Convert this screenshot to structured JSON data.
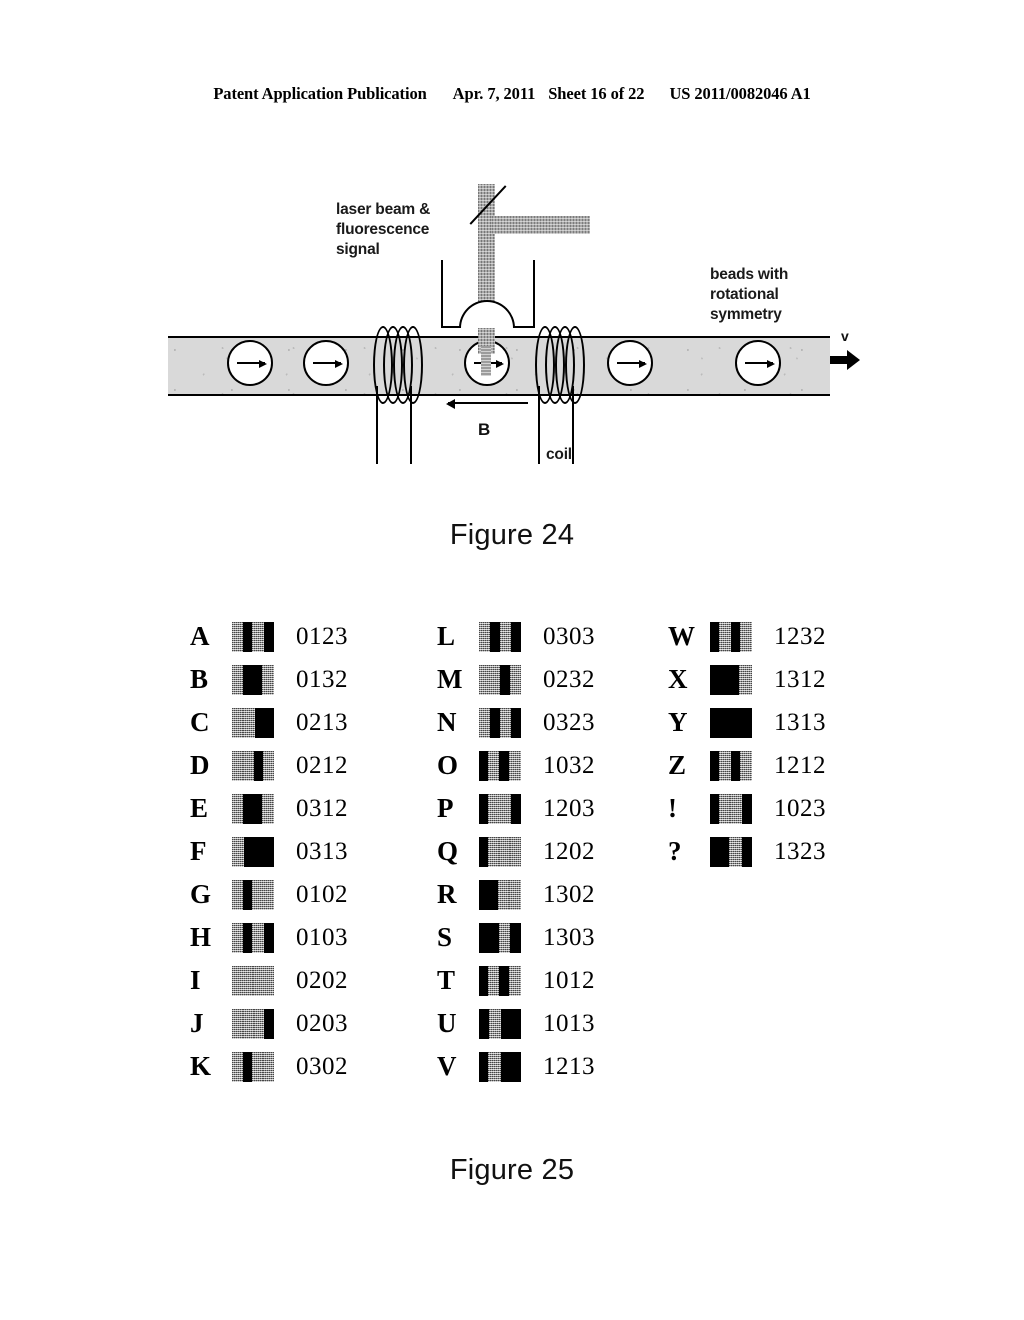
{
  "header": {
    "publication": "Patent Application Publication",
    "date": "Apr. 7, 2011",
    "sheet": "Sheet 16 of 22",
    "document_number": "US 2011/0082046 A1"
  },
  "figure24": {
    "caption": "Figure 24",
    "labels": {
      "laser": "laser beam &\nfluorescence\nsignal",
      "beads": "beads with\nrotational\nsymmetry",
      "coil": "coil",
      "bfield": "B",
      "velocity": "v"
    },
    "beads_count": 5,
    "coils_count": 2
  },
  "figure25": {
    "caption": "Figure 25",
    "columns": [
      {
        "entries": [
          {
            "letter": "A",
            "code": "0123"
          },
          {
            "letter": "B",
            "code": "0132"
          },
          {
            "letter": "C",
            "code": "0213"
          },
          {
            "letter": "D",
            "code": "0212"
          },
          {
            "letter": "E",
            "code": "0312"
          },
          {
            "letter": "F",
            "code": "0313"
          },
          {
            "letter": "G",
            "code": "0102"
          },
          {
            "letter": "H",
            "code": "0103"
          },
          {
            "letter": "I",
            "code": "0202"
          },
          {
            "letter": "J",
            "code": "0203"
          },
          {
            "letter": "K",
            "code": "0302"
          }
        ]
      },
      {
        "entries": [
          {
            "letter": "L",
            "code": "0303"
          },
          {
            "letter": "M",
            "code": "0232"
          },
          {
            "letter": "N",
            "code": "0323"
          },
          {
            "letter": "O",
            "code": "1032"
          },
          {
            "letter": "P",
            "code": "1203"
          },
          {
            "letter": "Q",
            "code": "1202"
          },
          {
            "letter": "R",
            "code": "1302"
          },
          {
            "letter": "S",
            "code": "1303"
          },
          {
            "letter": "T",
            "code": "1012"
          },
          {
            "letter": "U",
            "code": "1013"
          },
          {
            "letter": "V",
            "code": "1213"
          }
        ]
      },
      {
        "entries": [
          {
            "letter": "W",
            "code": "1232"
          },
          {
            "letter": "X",
            "code": "1312"
          },
          {
            "letter": "Y",
            "code": "1313"
          },
          {
            "letter": "Z",
            "code": "1212"
          },
          {
            "letter": "!",
            "code": "1023"
          },
          {
            "letter": "?",
            "code": "1323"
          }
        ]
      }
    ]
  },
  "colors": {
    "ink": "#000000",
    "channel_fill": "#d9d9d9",
    "beam_gray": "#a8a8a8",
    "barcode_gray": "#8d8d8d",
    "page_background": "#ffffff"
  }
}
